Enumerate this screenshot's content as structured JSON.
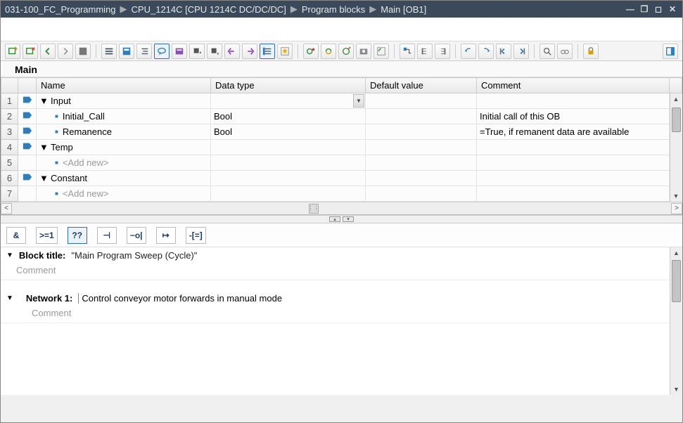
{
  "breadcrumb": {
    "p0": "031-100_FC_Programming",
    "p1": "CPU_1214C [CPU 1214C DC/DC/DC]",
    "p2": "Program blocks",
    "p3": "Main [OB1]"
  },
  "block_name": "Main",
  "columns": {
    "c0": "Name",
    "c1": "Data type",
    "c2": "Default value",
    "c3": "Comment"
  },
  "rows": {
    "r1": {
      "num": "1",
      "name": "Input",
      "type": "",
      "def": "",
      "comment": ""
    },
    "r2": {
      "num": "2",
      "name": "Initial_Call",
      "type": "Bool",
      "def": "",
      "comment": "Initial call of this OB"
    },
    "r3": {
      "num": "3",
      "name": "Remanence",
      "type": "Bool",
      "def": "",
      "comment": "=True, if remanent data are available"
    },
    "r4": {
      "num": "4",
      "name": "Temp",
      "type": "",
      "def": "",
      "comment": ""
    },
    "r5": {
      "num": "5",
      "name": "<Add new>",
      "type": "",
      "def": "",
      "comment": ""
    },
    "r6": {
      "num": "6",
      "name": "Constant",
      "type": "",
      "def": "",
      "comment": ""
    },
    "r7": {
      "num": "7",
      "name": "<Add new>",
      "type": "",
      "def": "",
      "comment": ""
    }
  },
  "lad_buttons": {
    "b0": "&",
    "b1": ">=1",
    "b2": "??",
    "b3": "⊣",
    "b4": "−o|",
    "b5": "↦",
    "b6": "-[=]"
  },
  "block_title": {
    "label": "Block title:",
    "value": "\"Main Program Sweep (Cycle)\"",
    "comment": "Comment"
  },
  "network": {
    "label": "Network 1:",
    "title": "Control conveyor motor forwards in manual mode",
    "comment": "Comment"
  }
}
